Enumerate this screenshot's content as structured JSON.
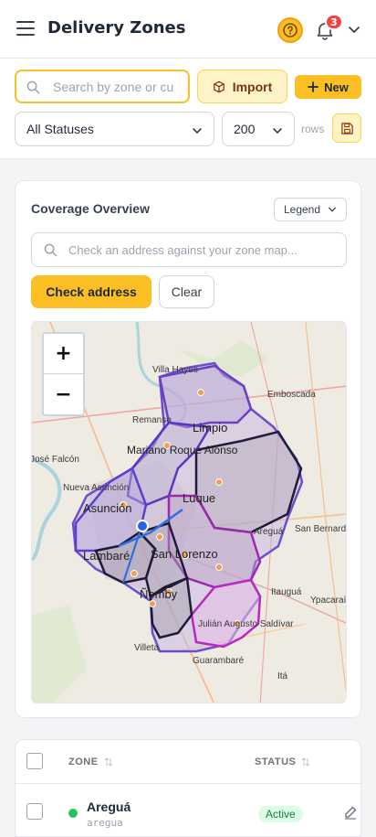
{
  "header": {
    "title": "Delivery Zones",
    "notification_count": "3"
  },
  "toolbar": {
    "search_placeholder": "Search by zone or cu",
    "import_label": "Import",
    "new_label": "New",
    "status_filter": "All Statuses",
    "rows_value": "200",
    "rows_label": "rows"
  },
  "coverage": {
    "title": "Coverage Overview",
    "legend_label": "Legend",
    "address_placeholder": "Check an address against your zone map...",
    "check_label": "Check address",
    "clear_label": "Clear",
    "zoom_in": "+",
    "zoom_out": "−",
    "map_labels": {
      "villa_hayes": "Villa Hayes",
      "emboscada": "Emboscada",
      "remanso": "Remanso",
      "limpio": "Limpio",
      "falcon": "José Falcón",
      "mariano": "Mariano Roque Alonso",
      "nueva_asuncion": "Nueva Asunción",
      "asuncion": "Asunción",
      "luque": "Luque",
      "aregua": "Areguá",
      "san_bernardino": "San Bernardino",
      "lambare": "Lambaré",
      "san_lorenzo": "San Lorenzo",
      "nemby": "Ñemby",
      "itaugua": "Itauguá",
      "ypacarai": "Ypacaraí",
      "julian": "Julián Augusto Saldívar",
      "guarambare": "Guarambaré",
      "villeta": "Villeta",
      "ita": "Itá"
    }
  },
  "table": {
    "col_zone": "ZONE",
    "col_status": "STATUS",
    "rows": [
      {
        "name": "Areguá",
        "slug": "aregua",
        "status": "Active"
      }
    ]
  },
  "colors": {
    "accent": "#fbbf24",
    "active": "#22c55e"
  }
}
